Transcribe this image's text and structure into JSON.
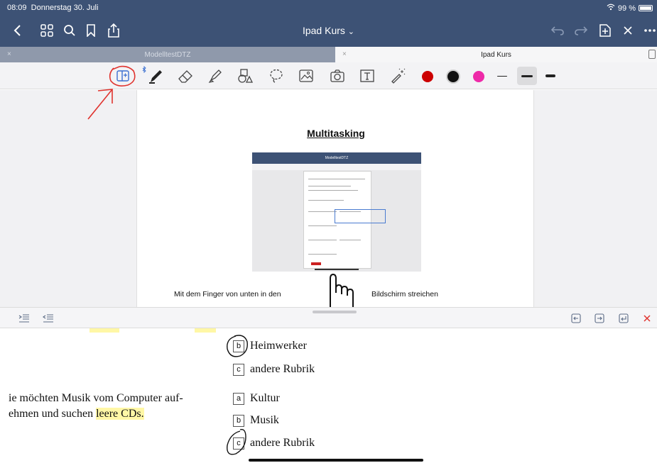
{
  "status": {
    "time": "08:09",
    "date": "Donnerstag 30. Juli",
    "battery": "99 %"
  },
  "nav": {
    "title": "Ipad Kurs",
    "chevron": "⌄"
  },
  "tabs": [
    {
      "label": "ModelltestDTZ",
      "close": "×"
    },
    {
      "label": "Ipad Kurs",
      "close": "×"
    }
  ],
  "toolbar": {
    "icons": [
      "split-view-icon",
      "pen-icon",
      "eraser-icon",
      "highlighter-icon",
      "shapes-icon",
      "lasso-icon",
      "image-icon",
      "camera-icon",
      "text-icon",
      "laser-pointer-icon"
    ],
    "colors": [
      "#cc0000",
      "#111111",
      "#ee2aa8"
    ]
  },
  "page": {
    "title": "Multitasking",
    "caption_left": "Mit dem Finger von unten in den",
    "caption_right": "Bildschirm streichen",
    "thumb_title": "ModelltestDTZ"
  },
  "doc": {
    "options": [
      {
        "letter": "b",
        "text": "Heimwerker"
      },
      {
        "letter": "c",
        "text": "andere Rubrik"
      },
      {
        "letter": "a",
        "text": "Kultur"
      },
      {
        "letter": "b",
        "text": "Musik"
      },
      {
        "letter": "c",
        "text": "andere Rubrik"
      }
    ],
    "question_line1": "ie möchten Musik vom Computer auf-",
    "question_line2_pre": "ehmen und suchen ",
    "question_line2_mark": "leere CDs."
  }
}
